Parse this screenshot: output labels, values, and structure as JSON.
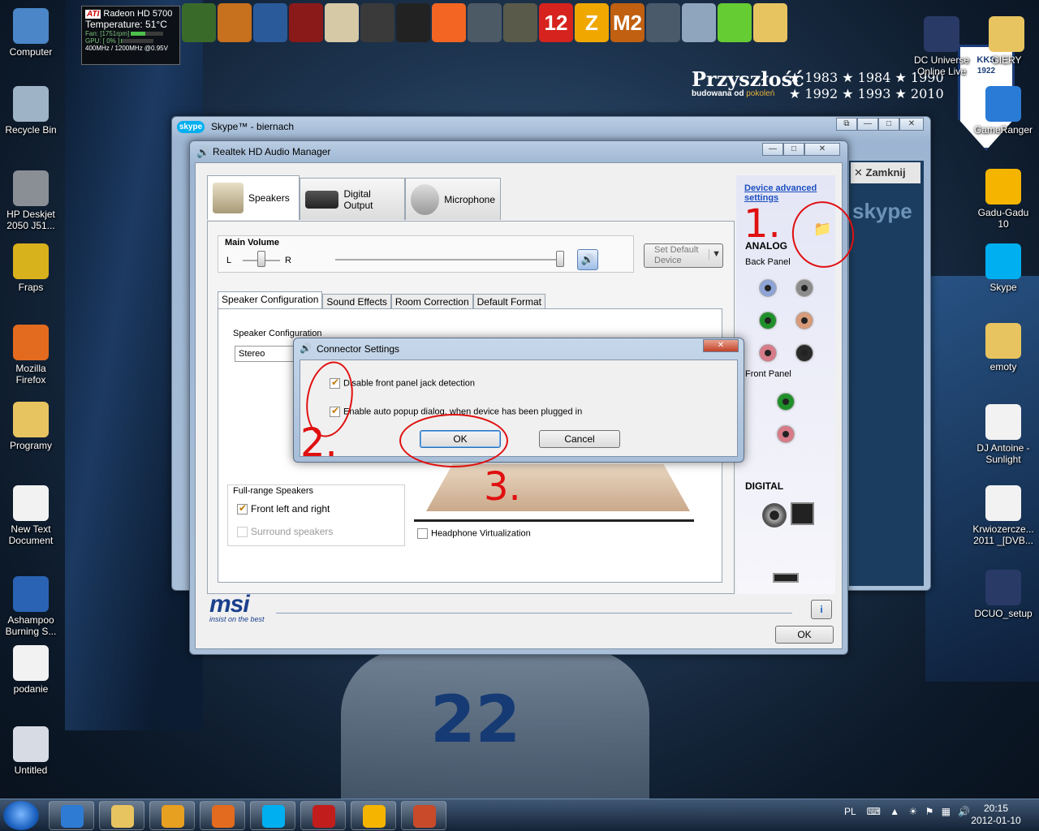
{
  "wallpaper": {
    "brand_title": "Przyszłość",
    "brand_sub_pre": "budowana od",
    "brand_sub_hl": "pokoleń",
    "years_row1": "★ 1983 ★ 1984 ★ 1990",
    "years_row2": "★ 1992 ★ 1993 ★ 2010",
    "crest_text": "KKS",
    "crest_year": "1922",
    "shirt_number": "22"
  },
  "gadget": {
    "brand": "ATI",
    "gpu_name": "Radeon HD 5700",
    "temp_label": "Temperature:",
    "temp_value": "51°C",
    "fan": "Fan: [1751rpm]",
    "gpu_load": "GPU: [ 0% ]",
    "clocks": "400MHz / 1200MHz @0.95V",
    "fan_fraction": 0.45,
    "gpu_fraction": 0.02
  },
  "desktop_left": [
    {
      "label": "Computer",
      "color": "#4a86c8"
    },
    {
      "label": "Recycle Bin",
      "color": "#9fb3c6"
    },
    {
      "label": "HP Deskjet 2050 J51...",
      "color": "#8a8f96"
    },
    {
      "label": "Fraps",
      "color": "#d8b21c"
    },
    {
      "label": "Mozilla Firefox",
      "color": "#e36b1f"
    },
    {
      "label": "Programy",
      "color": "#e8c460"
    },
    {
      "label": "New Text Document",
      "color": "#f2f2f2"
    },
    {
      "label": "Ashampoo Burning S...",
      "color": "#2a63b4"
    },
    {
      "label": "podanie",
      "color": "#f2f2f2"
    },
    {
      "label": "Untitled",
      "color": "#d7dce4"
    }
  ],
  "desktop_right": [
    {
      "label": "DC Universe Online Live",
      "color": "#2a3a66"
    },
    {
      "label": "GIERY",
      "color": "#e8c460"
    },
    {
      "label": "GameRanger",
      "color": "#2a7bd6"
    },
    {
      "label": "Gadu-Gadu 10",
      "color": "#f4b400"
    },
    {
      "label": "Skype",
      "color": "#00aff0"
    },
    {
      "label": "emoty",
      "color": "#e8c460"
    },
    {
      "label": "DJ Antoine - Sunlight",
      "color": "#f2f2f2"
    },
    {
      "label": "Krwiozercze... 2011 _[DVB...",
      "color": "#f2f2f2"
    },
    {
      "label": "DCUO_setup",
      "color": "#2a3a66"
    }
  ],
  "dock": {
    "items": [
      {
        "name": "car-game-icon",
        "color": "#3a6a2a"
      },
      {
        "name": "sunset-game-icon",
        "color": "#c7701d"
      },
      {
        "name": "sphere-game-icon",
        "color": "#2a5a9a"
      },
      {
        "name": "red-tree-game-icon",
        "color": "#8a1a1a"
      },
      {
        "name": "football-game-icon",
        "color": "#d6c9a6"
      },
      {
        "name": "call-of-duty-icon",
        "color": "#3a3a3a"
      },
      {
        "name": "skyrim-icon",
        "color": "#222222"
      },
      {
        "name": "origin-icon",
        "color": "#f26522"
      },
      {
        "name": "soldier-game-icon",
        "color": "#4c5a66"
      },
      {
        "name": "battlefield-icon",
        "color": "#5a5a4a"
      },
      {
        "name": "pes-12-icon",
        "color": "#d6231e"
      },
      {
        "name": "z-game-icon",
        "color": "#f0a800"
      },
      {
        "name": "m2-game-icon",
        "color": "#c06010"
      },
      {
        "name": "steam-icon",
        "color": "#4a5a6a"
      },
      {
        "name": "hd-tune-icon",
        "color": "#8fa5bd"
      },
      {
        "name": "green-app-icon",
        "color": "#66cc33"
      },
      {
        "name": "folder-icon",
        "color": "#e8c460"
      }
    ],
    "label_12": "12",
    "label_z": "Z",
    "label_m2": "M2"
  },
  "skype": {
    "logo": "skype",
    "title": "Skype™ - biernach",
    "zamknij": "✕ Zamknij",
    "bg_logo": "skype"
  },
  "realtek": {
    "title": "Realtek HD Audio Manager",
    "tabs": [
      "Speakers",
      "Digital Output",
      "Microphone"
    ],
    "main_volume_label": "Main Volume",
    "vol_left": "L",
    "vol_right": "R",
    "balance_fraction": 0.5,
    "volume_fraction": 1.0,
    "set_default_device": "Set Default Device",
    "subtabs": [
      "Speaker Configuration",
      "Sound Effects",
      "Room Correction",
      "Default Format"
    ],
    "speaker_config_label": "Speaker Configuration",
    "speaker_config_value": "Stereo",
    "full_range_label": "Full-range Speakers",
    "front_lr": "Front left and right",
    "surround": "Surround speakers",
    "headphone_virt": "Headphone Virtualization",
    "device_advanced_settings": "Device advanced settings",
    "analog": "ANALOG",
    "back_panel": "Back Panel",
    "front_panel": "Front Panel",
    "digital": "DIGITAL",
    "msi_logo": "msi",
    "msi_tagline": "insist on the best",
    "info_btn": "i",
    "ok": "OK",
    "jack_colors": {
      "blue": "#8ea4d6",
      "grey": "#8c8c8c",
      "green": "#1f8f2a",
      "orange": "#d79b7a",
      "pink": "#d77b88",
      "black": "#2a2a2a"
    }
  },
  "connector_dialog": {
    "title": "Connector Settings",
    "opt1": "Disable front panel jack detection",
    "opt2": "Enable auto popup dialog, when device has been plugged in",
    "ok": "OK",
    "cancel": "Cancel"
  },
  "annotations": {
    "n1": "1.",
    "n2": "2.",
    "n3": "3.",
    "color": "#e01010"
  },
  "taskbar": {
    "lang": "PL",
    "time": "20:15",
    "date": "2012-01-10",
    "apps": [
      {
        "name": "ie-taskbar-icon",
        "color": "#2e7bd4"
      },
      {
        "name": "explorer-taskbar-icon",
        "color": "#e8c460"
      },
      {
        "name": "media-player-taskbar-icon",
        "color": "#e8a020"
      },
      {
        "name": "firefox-taskbar-icon",
        "color": "#e36b1f"
      },
      {
        "name": "skype-taskbar-icon",
        "color": "#00aff0"
      },
      {
        "name": "acrobat-taskbar-icon",
        "color": "#c21d1d"
      },
      {
        "name": "gadu-taskbar-icon",
        "color": "#f4b400"
      },
      {
        "name": "realtek-taskbar-icon",
        "color": "#c84a2a"
      }
    ]
  }
}
